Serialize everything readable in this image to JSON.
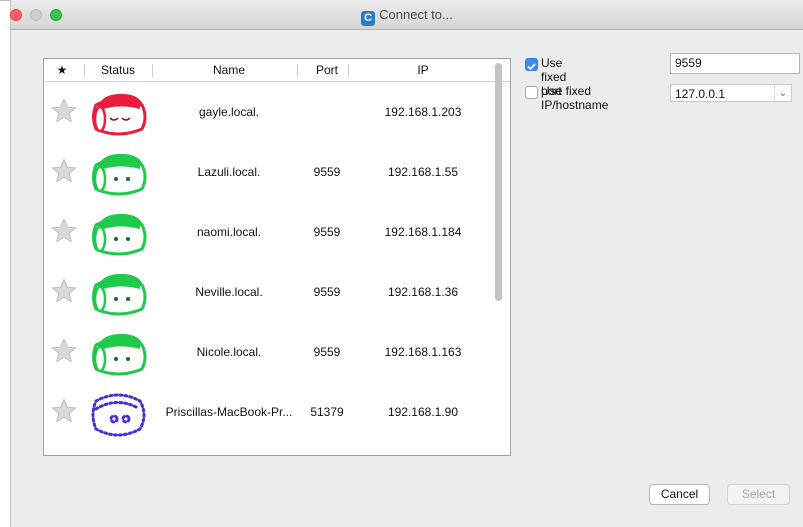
{
  "window": {
    "title": "Connect to...",
    "app_icon_letter": "C"
  },
  "table": {
    "headers": {
      "star": "★",
      "status": "Status",
      "name": "Name",
      "port": "Port",
      "ip": "IP"
    },
    "rows": [
      {
        "name": "gayle.local.",
        "port": "",
        "ip": "192.168.1.203",
        "status": "sleeping",
        "color": "#ee1c3c"
      },
      {
        "name": "Lazuli.local.",
        "port": "9559",
        "ip": "192.168.1.55",
        "status": "awake",
        "color": "#1fc94a"
      },
      {
        "name": "naomi.local.",
        "port": "9559",
        "ip": "192.168.1.184",
        "status": "awake",
        "color": "#1fc94a"
      },
      {
        "name": "Neville.local.",
        "port": "9559",
        "ip": "192.168.1.36",
        "status": "awake",
        "color": "#1fc94a"
      },
      {
        "name": "Nicole.local.",
        "port": "9559",
        "ip": "192.168.1.163",
        "status": "awake",
        "color": "#1fc94a"
      },
      {
        "name": "Priscillas-MacBook-Pr...",
        "port": "51379",
        "ip": "192.168.1.90",
        "status": "virtual",
        "color": "#4a2bd6"
      }
    ]
  },
  "options": {
    "fixed_port_label": "Use fixed port",
    "fixed_port_checked": true,
    "fixed_port_value": "9559",
    "fixed_ip_label": "Use fixed IP/hostname",
    "fixed_ip_checked": false,
    "fixed_ip_value": "127.0.0.1"
  },
  "buttons": {
    "cancel": "Cancel",
    "select": "Select"
  },
  "colors": {
    "accent": "#3d8ef0",
    "star_gray": "#d9d9d9"
  }
}
